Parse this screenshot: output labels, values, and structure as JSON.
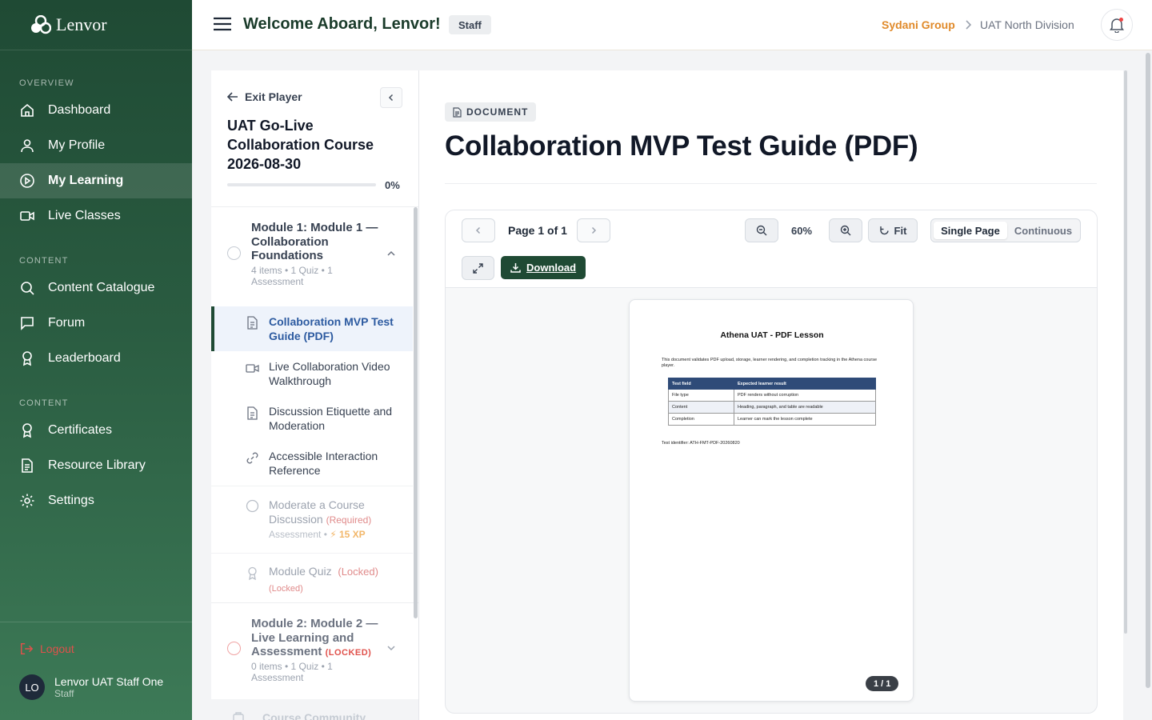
{
  "brand": {
    "name": "Lenvor"
  },
  "sidebar": {
    "sections": [
      "OVERVIEW",
      "CONTENT",
      "CONTENT"
    ],
    "items": [
      {
        "label": "Dashboard",
        "icon": "home-icon"
      },
      {
        "label": "My Profile",
        "icon": "user-icon"
      },
      {
        "label": "My Learning",
        "icon": "play-circle-icon",
        "active": true
      },
      {
        "label": "Live Classes",
        "icon": "video-icon"
      },
      {
        "label": "Content Catalogue",
        "icon": "search-icon"
      },
      {
        "label": "Forum",
        "icon": "chat-icon"
      },
      {
        "label": "Leaderboard",
        "icon": "award-icon"
      },
      {
        "label": "Certificates",
        "icon": "award-icon"
      },
      {
        "label": "Resource Library",
        "icon": "file-icon"
      },
      {
        "label": "Settings",
        "icon": "gear-icon"
      }
    ],
    "logout": "Logout",
    "user": {
      "initials": "LO",
      "name": "Lenvor UAT Staff One",
      "role": "Staff"
    }
  },
  "header": {
    "welcome": "Welcome Aboard, Lenvor!",
    "badge": "Staff",
    "org": "Sydani Group",
    "division": "UAT North Division"
  },
  "course": {
    "exit": "Exit Player",
    "title": "UAT Go-Live Collaboration Course 2026-08-30",
    "progress_pct": "0%",
    "progress_value": 0,
    "module1": {
      "title": "Module 1: Module 1 — Collaboration Foundations",
      "meta": "4 items • 1 Quiz • 1 Assessment",
      "lessons": [
        {
          "title": "Collaboration MVP Test Guide (PDF)",
          "icon": "document-icon"
        },
        {
          "title": "Live Collaboration Video Walkthrough",
          "icon": "video-icon"
        },
        {
          "title": "Discussion Etiquette and Moderation",
          "icon": "document-icon"
        },
        {
          "title": "Accessible Interaction Reference",
          "icon": "link-icon"
        }
      ],
      "assessment": {
        "title": "Moderate a Course Discussion",
        "required": "(Required)",
        "meta": "Assessment •",
        "xp": "⚡ 15 XP"
      },
      "quiz": {
        "title": "Module Quiz",
        "locked": "(Locked)",
        "sub_locked": "(Locked)"
      }
    },
    "module2": {
      "title": "Module 2: Module 2 — Live Learning and Assessment",
      "locked": "(LOCKED)",
      "meta": "0 items • 1 Quiz • 1 Assessment"
    },
    "community": "Course Community"
  },
  "main": {
    "badge": "DOCUMENT",
    "title": "Collaboration MVP Test Guide (PDF)",
    "viewer": {
      "page_label": "Page 1 of 1",
      "zoom": "60%",
      "fit": "Fit",
      "mode_single": "Single Page",
      "mode_continuous": "Continuous",
      "download": "Download",
      "pager": "1 / 1"
    },
    "pdf": {
      "heading": "Athena UAT - PDF Lesson",
      "paragraph": "This document validates PDF upload, storage, learner rendering, and completion tracking in the Athena course player.",
      "table_headers": [
        "Test field",
        "Expected learner result"
      ],
      "table_rows": [
        [
          "File type",
          "PDF renders without corruption"
        ],
        [
          "Content",
          "Heading, paragraph, and table are readable"
        ],
        [
          "Completion",
          "Learner can mark the lesson complete"
        ]
      ],
      "footer": "Test identifier: ATH-FMT-PDF-20260820"
    }
  },
  "colors": {
    "sidebar": "#1f4a34",
    "accent": "#2a5c41",
    "org": "#e08a2a",
    "danger": "#e0514b",
    "active_lesson": "#2c5aa0"
  }
}
